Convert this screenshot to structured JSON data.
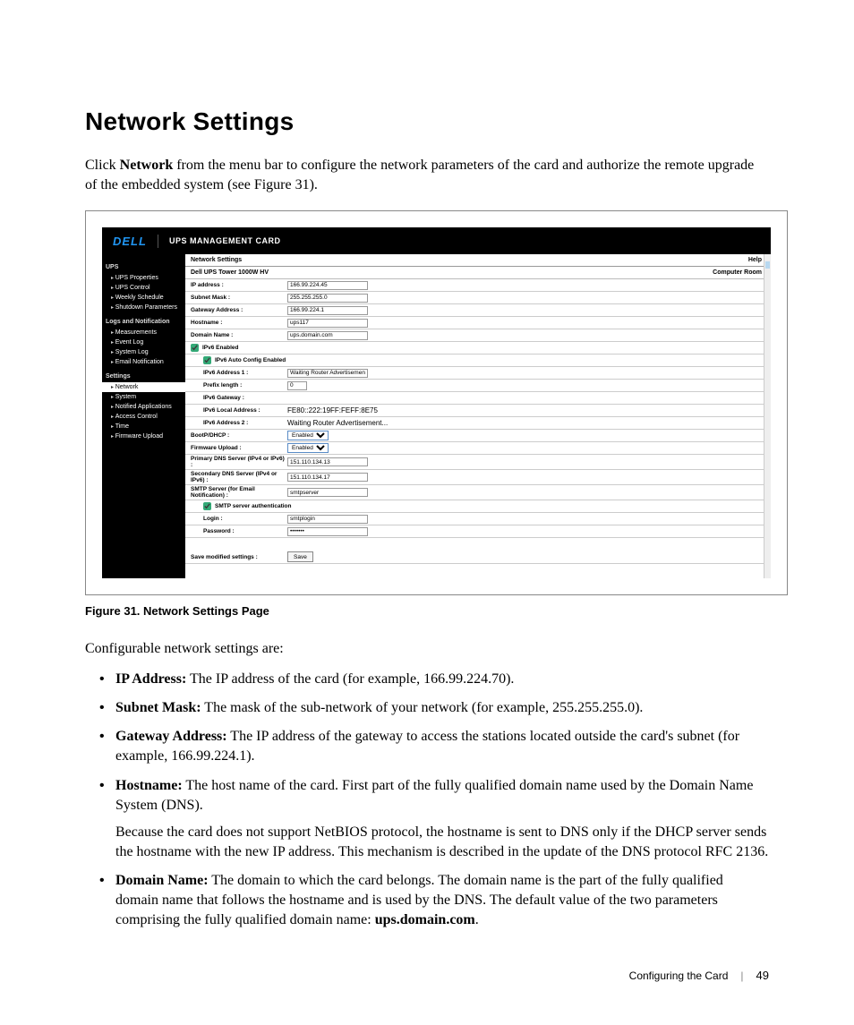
{
  "heading": "Network Settings",
  "intro": {
    "pre": "Click ",
    "bold": "Network",
    "post": " from the menu bar to configure the network parameters of the card and authorize the remote upgrade of the embedded system (see Figure 31)."
  },
  "figure": {
    "caption": "Figure 31. Network Settings Page",
    "header": {
      "logo": "DELL",
      "title": "UPS MANAGEMENT CARD"
    },
    "sidebar": {
      "sections": [
        {
          "head": "UPS",
          "items": [
            "UPS Properties",
            "UPS Control",
            "Weekly Schedule",
            "Shutdown Parameters"
          ]
        },
        {
          "head": "Logs and Notification",
          "items": [
            "Measurements",
            "Event Log",
            "System Log",
            "Email Notification"
          ]
        },
        {
          "head": "Settings",
          "items": [
            "Network",
            "System",
            "Notified Applications",
            "Access Control",
            "Time",
            "Firmware Upload"
          ]
        }
      ],
      "active": "Network"
    },
    "main": {
      "barLeft": "Network Settings",
      "barRight": "Help",
      "titleLeft": "Dell UPS Tower 1000W HV",
      "titleRight": "Computer Room",
      "rows": {
        "ip": {
          "lbl": "IP address :",
          "val": "166.99.224.45"
        },
        "mask": {
          "lbl": "Subnet Mask :",
          "val": "255.255.255.0"
        },
        "gw": {
          "lbl": "Gateway Address :",
          "val": "166.99.224.1"
        },
        "host": {
          "lbl": "Hostname :",
          "val": "ups117"
        },
        "domain": {
          "lbl": "Domain Name :",
          "val": "ups.domain.com"
        },
        "ipv6en": "IPv6 Enabled",
        "ipv6auto": "IPv6 Auto Config Enabled",
        "ipv6a1": {
          "lbl": "IPv6 Address 1 :",
          "val": "Waiting Router Advertisement..."
        },
        "prefix": {
          "lbl": "Prefix length :",
          "val": "0"
        },
        "ipv6gw": {
          "lbl": "IPv6 Gateway :",
          "val": ""
        },
        "ipv6local": {
          "lbl": "IPv6 Local Address :",
          "val": "FE80::222:19FF:FEFF:8E75"
        },
        "ipv6a2": {
          "lbl": "IPv6 Address 2 :",
          "val": "Waiting Router Advertisement..."
        },
        "bootp": {
          "lbl": "BootP/DHCP :",
          "val": "Enabled"
        },
        "fw": {
          "lbl": "Firmware Upload :",
          "val": "Enabled"
        },
        "dns1": {
          "lbl": "Primary DNS Server (IPv4 or IPv6) :",
          "val": "151.110.134.13"
        },
        "dns2": {
          "lbl": "Secondary DNS Server (IPv4 or IPv6) :",
          "val": "151.110.134.17"
        },
        "smtp": {
          "lbl": "SMTP Server (for Email Notification) :",
          "val": "smtpserver"
        },
        "smtpauth": "SMTP server authentication",
        "login": {
          "lbl": "Login :",
          "val": "smtplogin"
        },
        "pwd": {
          "lbl": "Password :",
          "val": "•••••••"
        },
        "save": {
          "lbl": "Save modified settings :",
          "btn": "Save"
        }
      }
    }
  },
  "subheading": "Configurable network settings are:",
  "defs": {
    "ip": {
      "t": "IP Address:",
      "d": " The IP address of the card (for example, 166.99.224.70)."
    },
    "mask": {
      "t": "Subnet Mask:",
      "d": " The mask of the sub-network of your network (for example, 255.255.255.0)."
    },
    "gw": {
      "t": "Gateway Address:",
      "d": " The IP address of the gateway to access the stations located outside the card's subnet (for example, 166.99.224.1)."
    },
    "host": {
      "t": "Hostname:",
      "d": " The host name of the card. First part of the fully qualified domain name used by the Domain Name System (DNS).",
      "p2": "Because the card does not support NetBIOS protocol, the hostname is sent to DNS only if the DHCP server sends the hostname with the new IP address. This mechanism is described in the update of the DNS protocol RFC 2136."
    },
    "dom": {
      "t": "Domain Name:",
      "d": " The domain to which the card belongs. The domain name is the part of the fully qualified domain name that follows the hostname and is used by the DNS. The default value of the two parameters comprising the fully qualified domain name: ",
      "b2": "ups.domain.com",
      "tail": "."
    }
  },
  "footer": {
    "section": "Configuring the Card",
    "page": "49"
  }
}
